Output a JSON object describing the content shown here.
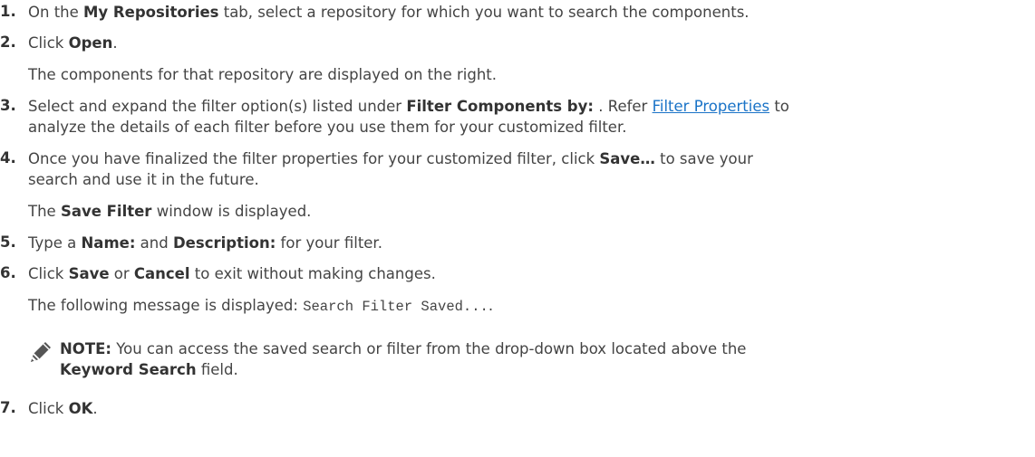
{
  "steps": [
    {
      "num": "1.",
      "pre": "On the ",
      "b1": "My Repositories",
      "post": " tab, select a repository for which you want to search the components."
    },
    {
      "num": "2.",
      "pre": "Click ",
      "b1": "Open",
      "post": ".",
      "result": "The components for that repository are displayed on the right."
    },
    {
      "num": "3.",
      "pre": "Select and expand the filter option(s) listed under ",
      "b1": "Filter Components by:",
      "mid": " . Refer ",
      "link": "Filter Properties",
      "post": " to",
      "cont": "analyze the details of each filter before you use them for your customized filter."
    },
    {
      "num": "4.",
      "pre": "Once you have finalized the filter properties for your customized filter, click ",
      "b1": "Save…",
      "post": " to save your",
      "cont": "search and use it in the future.",
      "result_pre": "The ",
      "result_b": "Save Filter",
      "result_post": " window is displayed."
    },
    {
      "num": "5.",
      "pre": "Type a ",
      "b1": "Name:",
      "mid": " and ",
      "b2": "Description:",
      "post": " for your filter."
    },
    {
      "num": "6.",
      "pre": "Click ",
      "b1": "Save",
      "mid": " or ",
      "b2": "Cancel",
      "post": " to exit without making changes.",
      "result_pre": "The following message is displayed: ",
      "result_code": "Search Filter Saved...",
      "result_post": "."
    },
    {
      "num": "7.",
      "pre": "Click ",
      "b1": "OK",
      "post": "."
    }
  ],
  "note": {
    "label": "NOTE:",
    "text": " You can access the saved search or filter from the drop-down box located above the",
    "b": "Keyword Search",
    "post": " field."
  }
}
